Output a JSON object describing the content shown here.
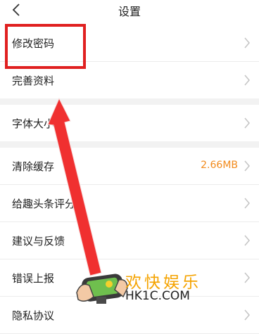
{
  "header": {
    "title": "设置"
  },
  "settings": {
    "group1": [
      {
        "label": "修改密码"
      },
      {
        "label": "完善资料"
      }
    ],
    "group2": [
      {
        "label": "字体大小"
      }
    ],
    "group3": [
      {
        "label": "清除缓存",
        "value": "2.66MB"
      },
      {
        "label": "给趣头条评分"
      },
      {
        "label": "建议与反馈"
      },
      {
        "label": "错误上报"
      },
      {
        "label": "隐私协议"
      }
    ]
  },
  "watermark": {
    "title": "欢快娱乐",
    "site": "HK1C.COM"
  },
  "colors": {
    "highlight": "#e02020",
    "accent": "#f28a1b"
  }
}
